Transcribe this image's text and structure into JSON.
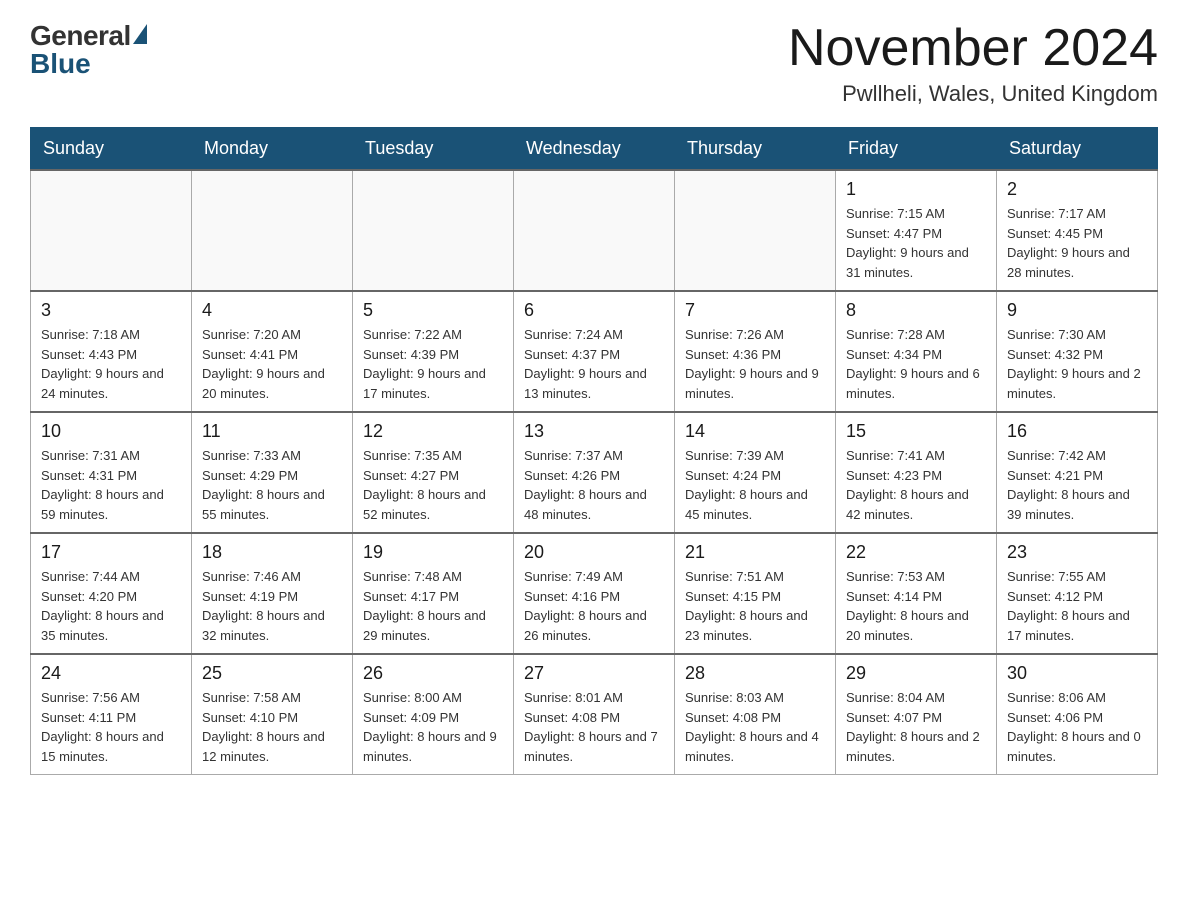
{
  "header": {
    "logo_general": "General",
    "logo_blue": "Blue",
    "month_title": "November 2024",
    "location": "Pwllheli, Wales, United Kingdom"
  },
  "weekdays": [
    "Sunday",
    "Monday",
    "Tuesday",
    "Wednesday",
    "Thursday",
    "Friday",
    "Saturday"
  ],
  "weeks": [
    [
      {
        "day": "",
        "info": ""
      },
      {
        "day": "",
        "info": ""
      },
      {
        "day": "",
        "info": ""
      },
      {
        "day": "",
        "info": ""
      },
      {
        "day": "",
        "info": ""
      },
      {
        "day": "1",
        "info": "Sunrise: 7:15 AM\nSunset: 4:47 PM\nDaylight: 9 hours and 31 minutes."
      },
      {
        "day": "2",
        "info": "Sunrise: 7:17 AM\nSunset: 4:45 PM\nDaylight: 9 hours and 28 minutes."
      }
    ],
    [
      {
        "day": "3",
        "info": "Sunrise: 7:18 AM\nSunset: 4:43 PM\nDaylight: 9 hours and 24 minutes."
      },
      {
        "day": "4",
        "info": "Sunrise: 7:20 AM\nSunset: 4:41 PM\nDaylight: 9 hours and 20 minutes."
      },
      {
        "day": "5",
        "info": "Sunrise: 7:22 AM\nSunset: 4:39 PM\nDaylight: 9 hours and 17 minutes."
      },
      {
        "day": "6",
        "info": "Sunrise: 7:24 AM\nSunset: 4:37 PM\nDaylight: 9 hours and 13 minutes."
      },
      {
        "day": "7",
        "info": "Sunrise: 7:26 AM\nSunset: 4:36 PM\nDaylight: 9 hours and 9 minutes."
      },
      {
        "day": "8",
        "info": "Sunrise: 7:28 AM\nSunset: 4:34 PM\nDaylight: 9 hours and 6 minutes."
      },
      {
        "day": "9",
        "info": "Sunrise: 7:30 AM\nSunset: 4:32 PM\nDaylight: 9 hours and 2 minutes."
      }
    ],
    [
      {
        "day": "10",
        "info": "Sunrise: 7:31 AM\nSunset: 4:31 PM\nDaylight: 8 hours and 59 minutes."
      },
      {
        "day": "11",
        "info": "Sunrise: 7:33 AM\nSunset: 4:29 PM\nDaylight: 8 hours and 55 minutes."
      },
      {
        "day": "12",
        "info": "Sunrise: 7:35 AM\nSunset: 4:27 PM\nDaylight: 8 hours and 52 minutes."
      },
      {
        "day": "13",
        "info": "Sunrise: 7:37 AM\nSunset: 4:26 PM\nDaylight: 8 hours and 48 minutes."
      },
      {
        "day": "14",
        "info": "Sunrise: 7:39 AM\nSunset: 4:24 PM\nDaylight: 8 hours and 45 minutes."
      },
      {
        "day": "15",
        "info": "Sunrise: 7:41 AM\nSunset: 4:23 PM\nDaylight: 8 hours and 42 minutes."
      },
      {
        "day": "16",
        "info": "Sunrise: 7:42 AM\nSunset: 4:21 PM\nDaylight: 8 hours and 39 minutes."
      }
    ],
    [
      {
        "day": "17",
        "info": "Sunrise: 7:44 AM\nSunset: 4:20 PM\nDaylight: 8 hours and 35 minutes."
      },
      {
        "day": "18",
        "info": "Sunrise: 7:46 AM\nSunset: 4:19 PM\nDaylight: 8 hours and 32 minutes."
      },
      {
        "day": "19",
        "info": "Sunrise: 7:48 AM\nSunset: 4:17 PM\nDaylight: 8 hours and 29 minutes."
      },
      {
        "day": "20",
        "info": "Sunrise: 7:49 AM\nSunset: 4:16 PM\nDaylight: 8 hours and 26 minutes."
      },
      {
        "day": "21",
        "info": "Sunrise: 7:51 AM\nSunset: 4:15 PM\nDaylight: 8 hours and 23 minutes."
      },
      {
        "day": "22",
        "info": "Sunrise: 7:53 AM\nSunset: 4:14 PM\nDaylight: 8 hours and 20 minutes."
      },
      {
        "day": "23",
        "info": "Sunrise: 7:55 AM\nSunset: 4:12 PM\nDaylight: 8 hours and 17 minutes."
      }
    ],
    [
      {
        "day": "24",
        "info": "Sunrise: 7:56 AM\nSunset: 4:11 PM\nDaylight: 8 hours and 15 minutes."
      },
      {
        "day": "25",
        "info": "Sunrise: 7:58 AM\nSunset: 4:10 PM\nDaylight: 8 hours and 12 minutes."
      },
      {
        "day": "26",
        "info": "Sunrise: 8:00 AM\nSunset: 4:09 PM\nDaylight: 8 hours and 9 minutes."
      },
      {
        "day": "27",
        "info": "Sunrise: 8:01 AM\nSunset: 4:08 PM\nDaylight: 8 hours and 7 minutes."
      },
      {
        "day": "28",
        "info": "Sunrise: 8:03 AM\nSunset: 4:08 PM\nDaylight: 8 hours and 4 minutes."
      },
      {
        "day": "29",
        "info": "Sunrise: 8:04 AM\nSunset: 4:07 PM\nDaylight: 8 hours and 2 minutes."
      },
      {
        "day": "30",
        "info": "Sunrise: 8:06 AM\nSunset: 4:06 PM\nDaylight: 8 hours and 0 minutes."
      }
    ]
  ]
}
